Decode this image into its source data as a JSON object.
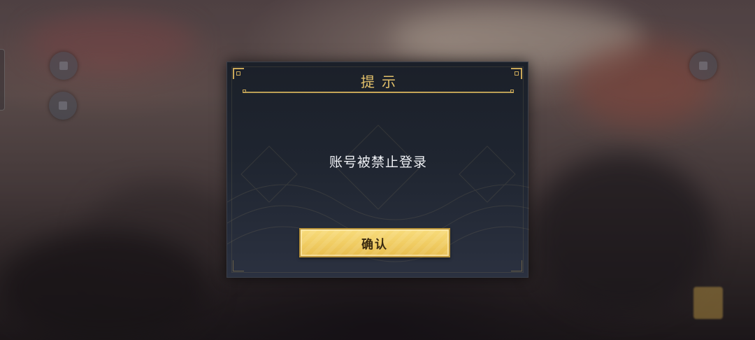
{
  "dialog": {
    "title": "提示",
    "message": "账号被禁止登录",
    "confirm_label": "确认"
  },
  "colors": {
    "title_gold": "#e2c06a",
    "button_gold": "#f0cc62",
    "panel_dark": "#1f2530"
  },
  "icons": {
    "left_top": "menu-icon",
    "left_bottom": "menu-icon",
    "right_top": "menu-icon"
  }
}
